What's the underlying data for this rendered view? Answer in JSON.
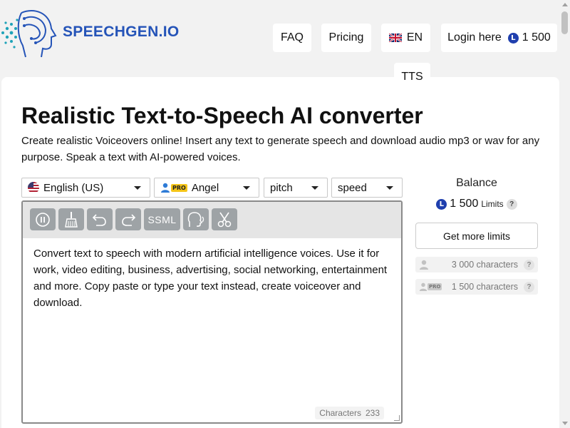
{
  "header": {
    "logo_text": "SPEECHGEN.IO",
    "nav": {
      "faq": "FAQ",
      "pricing": "Pricing",
      "lang": "EN",
      "login": "Login here",
      "login_balance": "1 500",
      "tts": "TTS"
    }
  },
  "main": {
    "title": "Realistic Text-to-Speech AI converter",
    "subtitle": "Create realistic Voiceovers online! Insert any text to generate speech and download audio mp3 or wav for any purpose. Speak a text with AI-powered voices.",
    "selects": {
      "language": "English (US)",
      "voice_badge": "PRO",
      "voice": "Angel",
      "pitch": "pitch",
      "speed": "speed"
    },
    "toolbar": {
      "ssml_label": "SSML"
    },
    "editor": {
      "text": "Convert text to speech with modern artificial intelligence voices. Use it for work, video editing, business, advertising, social networking, entertainment and more. Copy paste or type your text instead, create voiceover and download.",
      "characters_label": "Characters",
      "characters_count": "233"
    }
  },
  "balance": {
    "title": "Balance",
    "amount": "1 500",
    "limits_label": "Limits",
    "help": "?",
    "get_limits": "Get more limits",
    "free_limit": "3 000 characters",
    "pro_badge": "PRO",
    "pro_limit": "1 500 characters",
    "coin_symbol": "L"
  },
  "colors": {
    "brand": "#2554b8",
    "coin": "#1f3fae",
    "tool_button": "#9ea3a6",
    "pro_badge": "#f5c518"
  }
}
